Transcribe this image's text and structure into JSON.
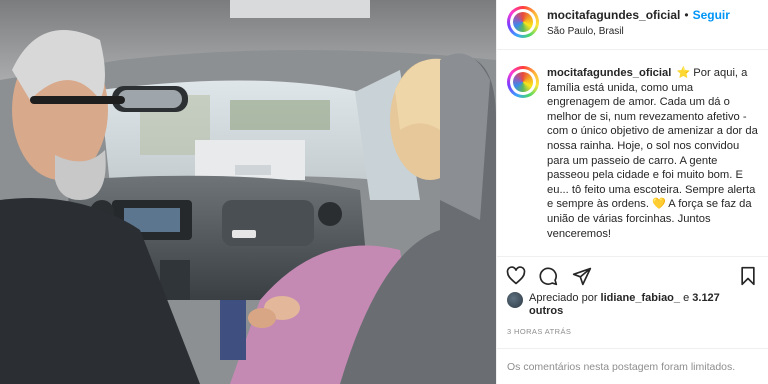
{
  "photo": {
    "alt_icon": "photo-car-scene"
  },
  "header": {
    "username": "mocitafagundes_oficial",
    "separator": "•",
    "follow_label": "Seguir",
    "location": "São Paulo, Brasil",
    "avatar_icon": "rainbow-avatar"
  },
  "caption": {
    "username": "mocitafagundes_oficial",
    "star_emoji": "⭐",
    "text_1": " Por aqui, a família está unida, como uma engrenagem de amor. Cada um dá o melhor de si, num revezamento afetivo - com o único objetivo de amenizar a dor da nossa rainha. Hoje, o sol nos convidou para um passeio de carro. A gente passeou pela cidade e foi muito bom. E eu... tô feito uma escoteira. Sempre alerta e sempre às ordens. ",
    "heart_emoji": "💛",
    "text_2": " A força se faz da união de várias forcinhas. Juntos venceremos!"
  },
  "actions": {
    "like_icon": "heart-icon",
    "comment_icon": "comment-icon",
    "share_icon": "share-icon",
    "save_icon": "bookmark-icon"
  },
  "likes": {
    "prefix": "Apreciado por ",
    "user": "lidiane_fabiao_",
    "middle": " e ",
    "count": "3.127 outros"
  },
  "timestamp": "3 HORAS ATRÁS",
  "comments_disabled": "Os comentários nesta postagem foram limitados.",
  "colors": {
    "follow_blue": "#0095f6",
    "muted_gray": "#8e8e8e",
    "text_dark": "#262626",
    "border": "#efefef"
  }
}
